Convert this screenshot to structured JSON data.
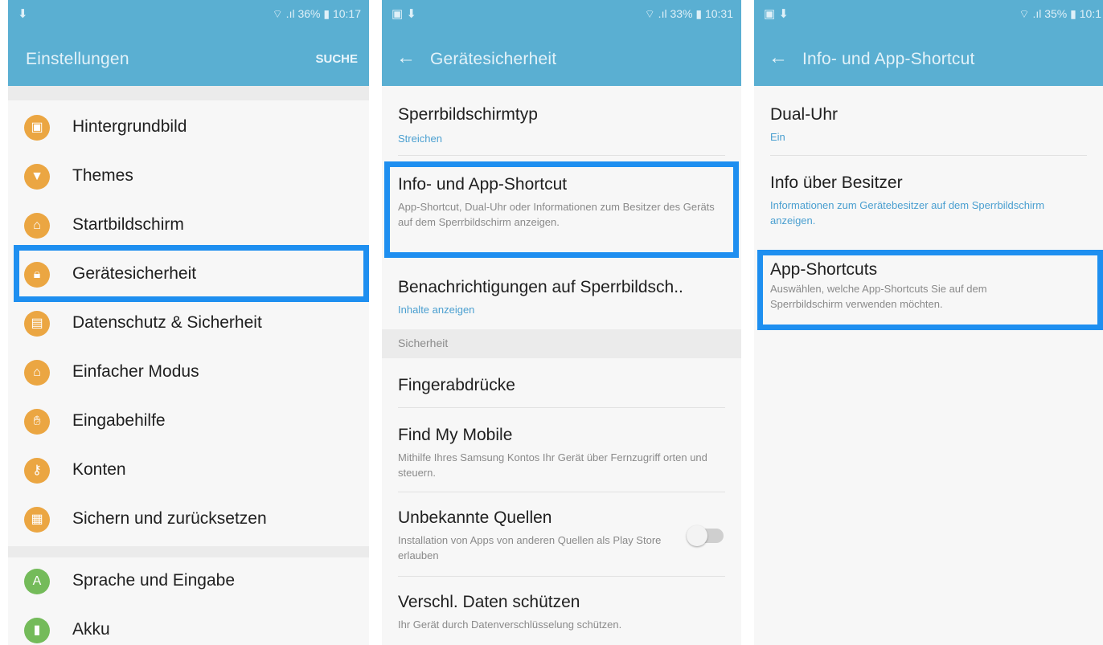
{
  "colors": {
    "accent": "#5aafd2",
    "icon_orange": "#eba642",
    "icon_green": "#74bb5a",
    "highlight": "#1e8ff0"
  },
  "panel1": {
    "status_left": "⬇",
    "status_right": "⌔ .ıl 36% ▮ 10:17",
    "title": "Einstellungen",
    "action": "SUCHE",
    "items": [
      {
        "label": "Hintergrundbild",
        "icon": "wallpaper-icon"
      },
      {
        "label": "Themes",
        "icon": "brush-icon"
      },
      {
        "label": "Startbildschirm",
        "icon": "home-icon"
      },
      {
        "label": "Gerätesicherheit",
        "icon": "lock-icon"
      },
      {
        "label": "Datenschutz & Sicherheit",
        "icon": "privacy-icon"
      },
      {
        "label": "Einfacher Modus",
        "icon": "easy-mode-icon"
      },
      {
        "label": "Eingabehilfe",
        "icon": "hand-icon"
      },
      {
        "label": "Konten",
        "icon": "key-icon"
      },
      {
        "label": "Sichern und zurücksetzen",
        "icon": "backup-icon"
      },
      {
        "label": "Sprache und Eingabe",
        "icon": "language-icon"
      },
      {
        "label": "Akku",
        "icon": "battery-icon"
      }
    ]
  },
  "panel2": {
    "status_left": "▣ ⬇",
    "status_right": "⌔ .ıl 33% ▮ 10:31",
    "title": "Gerätesicherheit",
    "items": [
      {
        "title": "Sperrbildschirmtyp",
        "sub": "Streichen"
      },
      {
        "title": "Info- und App-Shortcut",
        "sub": "App-Shortcut, Dual-Uhr oder Informationen zum Besitzer des Geräts auf dem Sperrbildschirm anzeigen."
      },
      {
        "title": "Benachrichtigungen auf Sperrbildsch..",
        "sub": "Inhalte anzeigen"
      }
    ],
    "section": "Sicherheit",
    "items2": [
      {
        "title": "Fingerabdrücke"
      },
      {
        "title": "Find My Mobile",
        "sub": "Mithilfe Ihres Samsung Kontos Ihr Gerät über Fernzugriff orten und steuern."
      },
      {
        "title": "Unbekannte Quellen",
        "sub": "Installation von Apps von anderen Quellen als Play Store erlauben",
        "toggle_on": false
      },
      {
        "title": "Verschl. Daten schützen",
        "sub": "Ihr Gerät durch Datenverschlüsselung schützen."
      }
    ]
  },
  "panel3": {
    "status_left": "▣ ⬇",
    "status_right": "⌔ .ıl 35% ▮ 10:1",
    "title": "Info- und App-Shortcut",
    "items": [
      {
        "title": "Dual-Uhr",
        "sub": "Ein"
      },
      {
        "title": "Info über Besitzer",
        "sub": "Informationen zum Gerätebesitzer auf dem Sperrbildschirm anzeigen."
      },
      {
        "title": "App-Shortcuts",
        "sub": "Auswählen, welche App-Shortcuts Sie auf dem Sperrbildschirm verwenden möchten."
      }
    ]
  }
}
